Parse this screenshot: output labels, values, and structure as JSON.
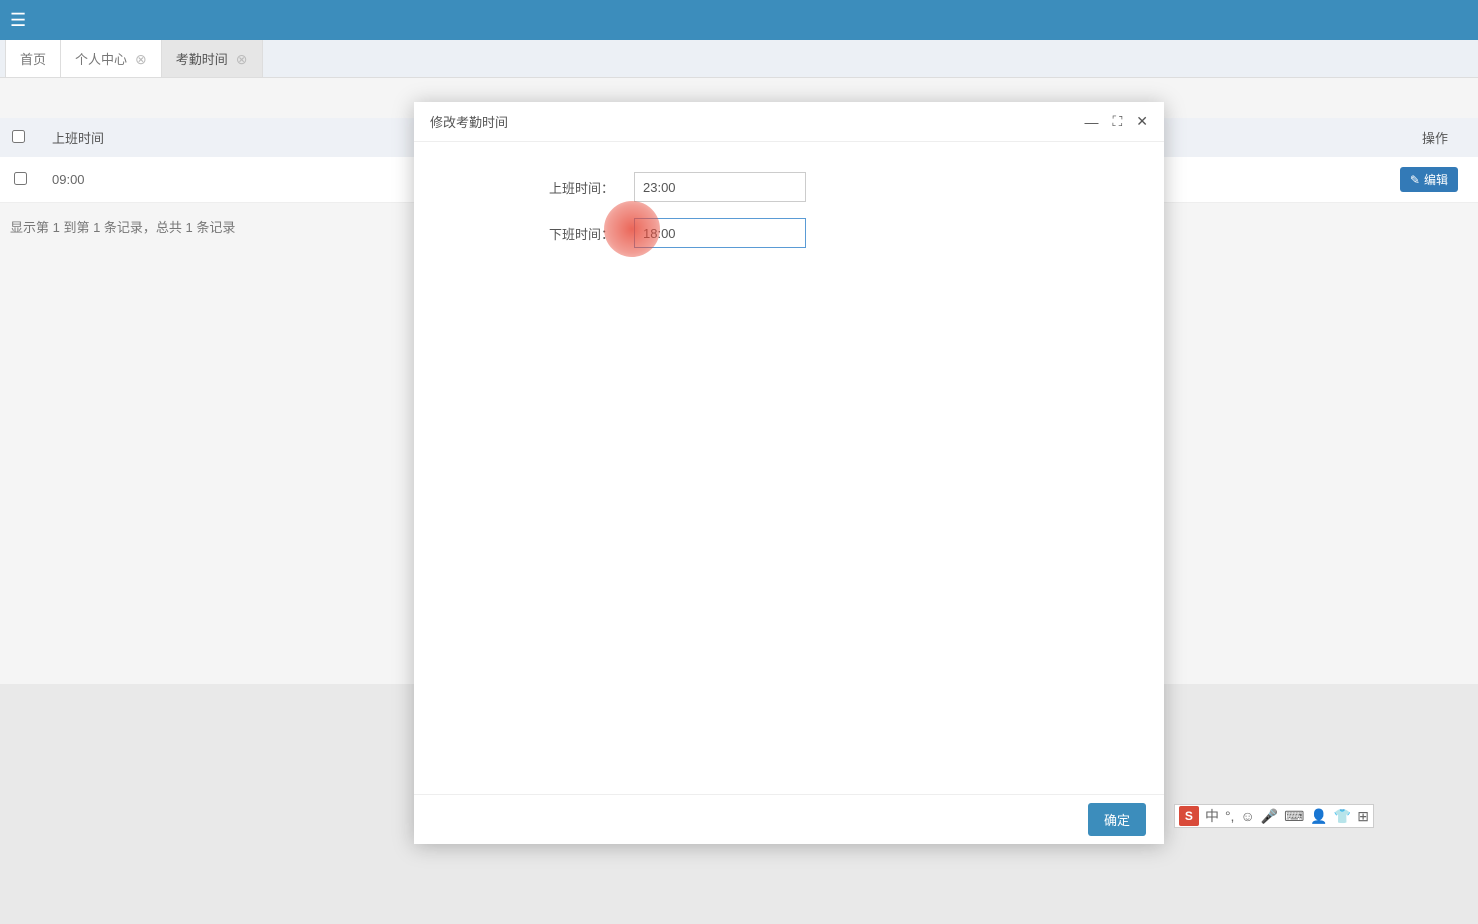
{
  "topbar": {},
  "tabs": {
    "home": "首页",
    "profile": "个人中心",
    "attendance": "考勤时间"
  },
  "table": {
    "header_checkin": "上班时间",
    "header_actions": "操作",
    "row1_time": "09:00",
    "edit_label": "编辑"
  },
  "pagination": "显示第 1 到第 1 条记录，总共 1 条记录",
  "modal": {
    "title": "修改考勤时间",
    "label_checkin": "上班时间：",
    "label_checkout": "下班时间：",
    "value_checkin": "23:00",
    "value_checkout": "18:00",
    "btn_confirm": "确定"
  },
  "ime": {
    "logo": "S",
    "lang": "中"
  }
}
